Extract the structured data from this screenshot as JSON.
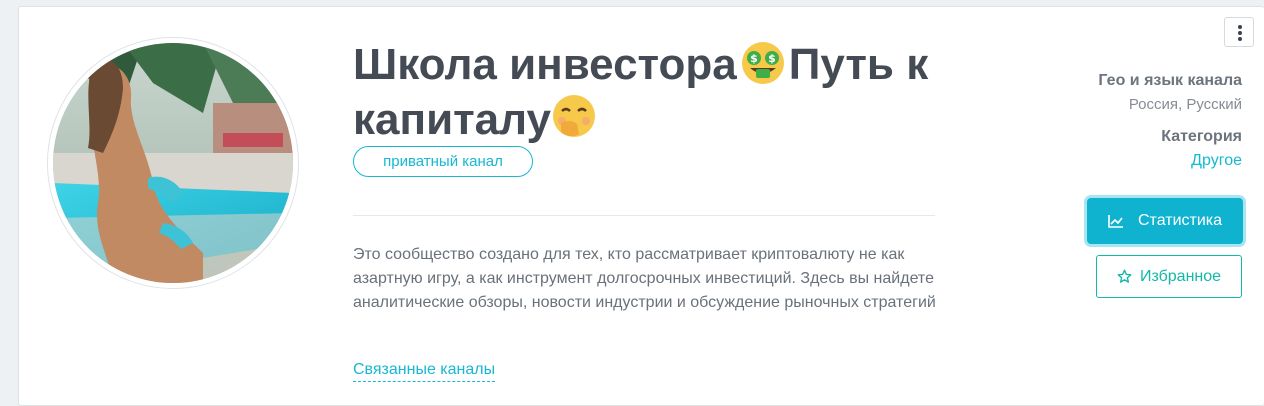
{
  "channel": {
    "title_part1": "Школа инвестора",
    "title_part2": "Путь к",
    "title_part3": "капиталу",
    "emoji_1": "money-mouth-face-emoji",
    "emoji_2": "face-with-hand-over-mouth-emoji",
    "privacy_tag": "приватный канал",
    "description": "Это сообщество создано для тех, кто рассматривает криптовалюту не как азартную игру, а как инструмент долгосрочных инвестиций. Здесь вы найдете аналитические обзоры, новости индустрии и обсуждение рыночных стратегий",
    "related_link": "Связанные каналы"
  },
  "sidebar": {
    "geo_label": "Гео и язык канала",
    "geo_value": "Россия, Русский",
    "category_label": "Категория",
    "category_value": "Другое"
  },
  "actions": {
    "stats_label": "Статистика",
    "stats_icon": "line-chart-icon",
    "favorite_label": "Избранное",
    "favorite_icon": "star-outline-icon",
    "menu_icon": "kebab-menu-icon"
  },
  "colors": {
    "accent": "#16b8d2",
    "button_fill": "#0fb3d0",
    "favorite_accent": "#14b8a6",
    "title": "#444b55"
  }
}
